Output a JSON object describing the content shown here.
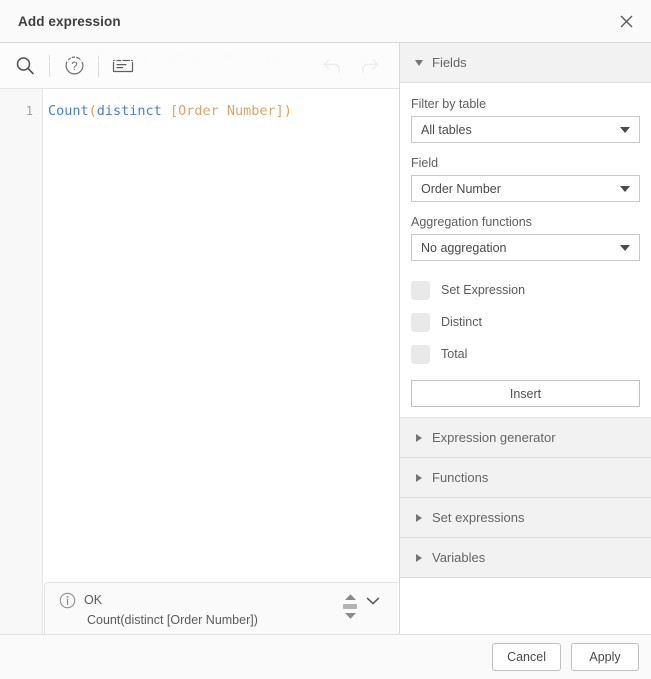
{
  "dialog": {
    "title": "Add expression",
    "close_icon": "close-icon"
  },
  "editor": {
    "toolbar": {
      "search_icon": "search-icon",
      "help_icon": "help-circle-icon",
      "comment_icon": "insert-comment-icon",
      "undo_icon": "undo-icon",
      "redo_icon": "redo-icon",
      "ghost_text": "Count(distinct [Order Number])"
    },
    "line_number": "1",
    "expression": "Count(distinct [Order Number])",
    "tokens": {
      "fn": "Count",
      "open_paren": "(",
      "keyword": "distinct",
      "space": " ",
      "field": "[Order Number]",
      "close_paren": ")"
    },
    "status": {
      "info_icon": "info-icon",
      "state": "OK",
      "detail": "Count(distinct [Order Number])",
      "scroll_up_icon": "scroll-up-icon",
      "scroll_down_icon": "scroll-down-icon",
      "collapse_icon": "chevron-down-icon"
    }
  },
  "side": {
    "fields_section": {
      "title": "Fields",
      "expanded": true,
      "filter_label": "Filter by table",
      "filter_value": "All tables",
      "field_label": "Field",
      "field_value": "Order Number",
      "aggregation_label": "Aggregation functions",
      "aggregation_value": "No aggregation",
      "checkboxes": [
        {
          "label": "Set Expression",
          "checked": false
        },
        {
          "label": "Distinct",
          "checked": false
        },
        {
          "label": "Total",
          "checked": false
        }
      ],
      "insert_label": "Insert"
    },
    "sections": [
      {
        "title": "Expression generator",
        "expanded": false
      },
      {
        "title": "Functions",
        "expanded": false
      },
      {
        "title": "Set expressions",
        "expanded": false
      },
      {
        "title": "Variables",
        "expanded": false
      }
    ]
  },
  "footer": {
    "cancel_label": "Cancel",
    "apply_label": "Apply"
  },
  "colors": {
    "token_function": "#4a7fd6",
    "token_keyword": "#4a7fd6",
    "token_paren": "#e8a33d",
    "token_field": "#d9a76a",
    "panel_header_bg": "#f2f2f2",
    "dialog_header_bg": "#fafafa"
  }
}
